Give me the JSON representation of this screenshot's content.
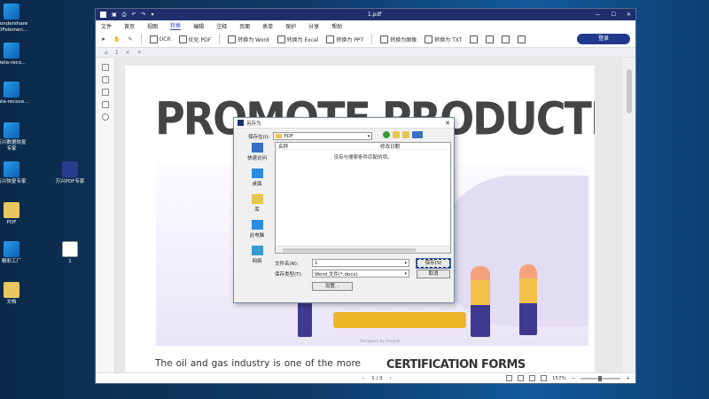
{
  "desktop": {
    "icons": [
      {
        "label": "Wondershare\nPDFelemen...",
        "color": "blue"
      },
      {
        "label": "Data-reco...",
        "color": "blue"
      },
      {
        "label": "Data-recove...",
        "color": "blue"
      },
      {
        "label": "万兴数据恢复\n专家",
        "color": "blue"
      },
      {
        "label": "万兴恢复专家",
        "color": "blue"
      },
      {
        "label": "PDF",
        "color": "yellow"
      },
      {
        "label": "精彩工厂",
        "color": "blue"
      },
      {
        "label": "文档",
        "color": "yellow"
      }
    ],
    "icons_col2": [
      {
        "label": "万兴PDF专家",
        "color": "navy"
      },
      {
        "label": "1",
        "color": "file"
      }
    ]
  },
  "window": {
    "title": "1.pdf",
    "menu": [
      "文件",
      "首页",
      "视图",
      "转换",
      "编辑",
      "注释",
      "页面",
      "表单",
      "保护",
      "分享",
      "帮助"
    ],
    "active_menu": "转换",
    "toolbar": [
      "OCR",
      "优化 PDF",
      "转换为 Word",
      "转换为 Excel",
      "转换为 PPT",
      "转换为图像",
      "转换为 TXT"
    ],
    "tab_label": "1",
    "login_label": "登录"
  },
  "document": {
    "headline": "PROMOTE PRODUCTIVITY",
    "illustration_credit": "Designed by Freepik",
    "body_text": "The oil and gas industry is one of the more scrutinized businesses in the world. Primarily",
    "section_heading": "CERTIFICATION FORMS"
  },
  "statusbar": {
    "page": "1 / 3",
    "zoom": "157%"
  },
  "dialog": {
    "title": "另存为",
    "lookin_label": "保存在(I):",
    "lookin_value": "PDF",
    "columns": [
      "名称",
      "修改日期"
    ],
    "empty_message": "没有与搜索条件匹配的项。",
    "places": [
      "快速访问",
      "桌面",
      "库",
      "此电脑",
      "网络"
    ],
    "filename_label": "文件名(N):",
    "filename_value": "1",
    "filetype_label": "保存类型(T):",
    "filetype_value": "Word 文件(*.docx)",
    "save_label": "保存(S)",
    "cancel_label": "取消",
    "settings_label": "设置..."
  }
}
